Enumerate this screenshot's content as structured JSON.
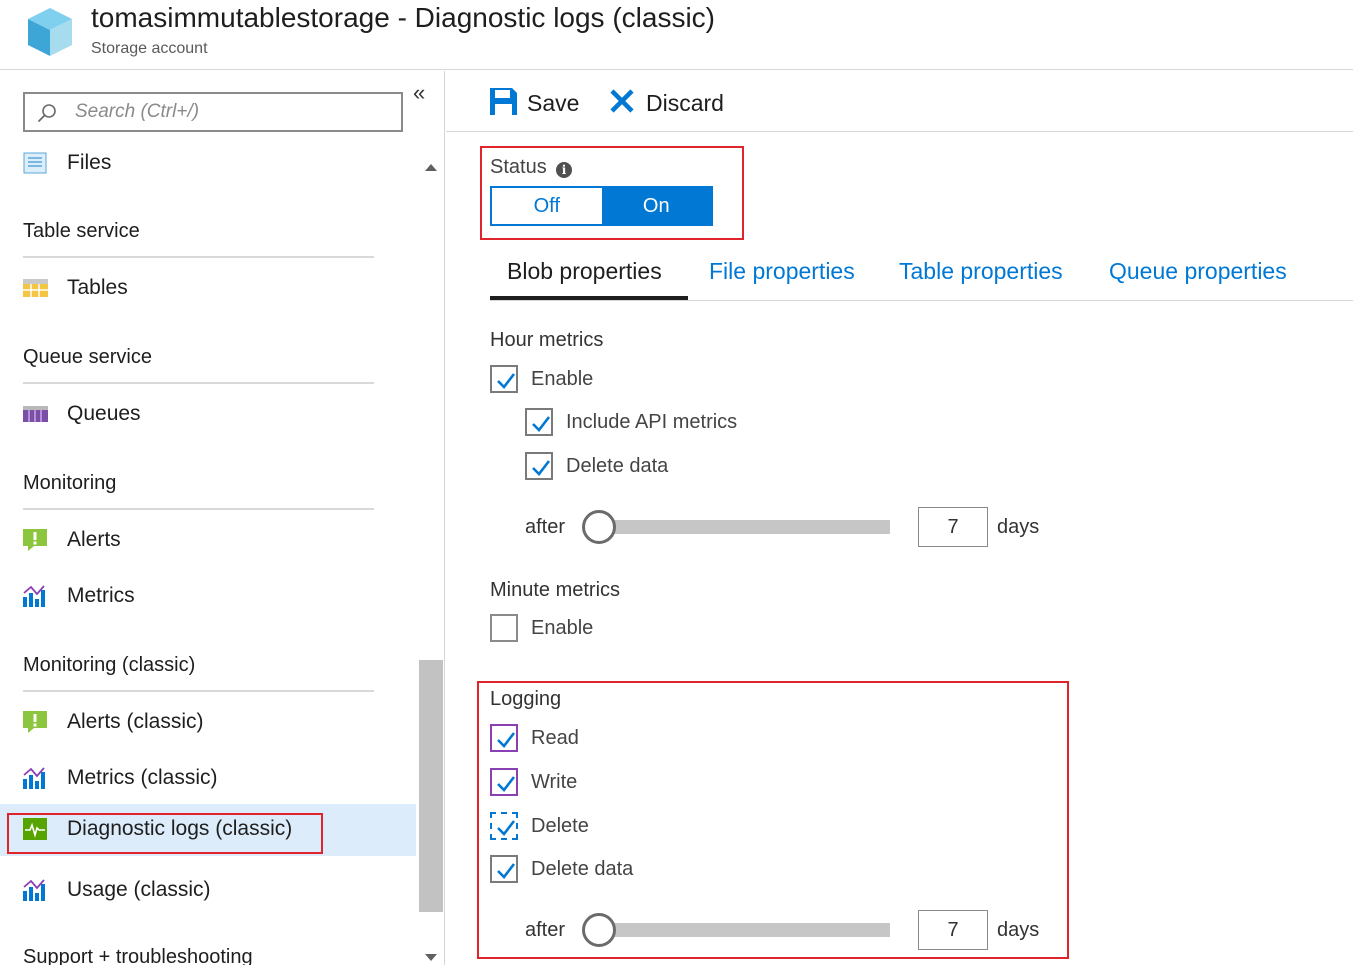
{
  "header": {
    "title": "tomasimmutablestorage - Diagnostic logs (classic)",
    "subtitle": "Storage account",
    "icon": "storage-cube-icon"
  },
  "sidebar": {
    "search_placeholder": "Search (Ctrl+/)",
    "collapse_glyph": "«",
    "items": [
      {
        "type": "item",
        "label": "Files",
        "icon": "files-icon"
      },
      {
        "type": "section",
        "label": "Table service"
      },
      {
        "type": "item",
        "label": "Tables",
        "icon": "tables-icon"
      },
      {
        "type": "section",
        "label": "Queue service"
      },
      {
        "type": "item",
        "label": "Queues",
        "icon": "queues-icon"
      },
      {
        "type": "section",
        "label": "Monitoring"
      },
      {
        "type": "item",
        "label": "Alerts",
        "icon": "alert-icon"
      },
      {
        "type": "item",
        "label": "Metrics",
        "icon": "metrics-icon"
      },
      {
        "type": "section",
        "label": "Monitoring (classic)"
      },
      {
        "type": "item",
        "label": "Alerts (classic)",
        "icon": "alert-icon"
      },
      {
        "type": "item",
        "label": "Metrics (classic)",
        "icon": "metrics-icon"
      },
      {
        "type": "item",
        "label": "Diagnostic logs (classic)",
        "icon": "diagnostic-logs-icon",
        "selected": true
      },
      {
        "type": "item",
        "label": "Usage (classic)",
        "icon": "metrics-icon"
      },
      {
        "type": "section",
        "label": "Support + troubleshooting"
      }
    ]
  },
  "toolbar": {
    "save_label": "Save",
    "discard_label": "Discard"
  },
  "status": {
    "label": "Status",
    "off_label": "Off",
    "on_label": "On",
    "value": "On"
  },
  "tabs": [
    {
      "label": "Blob properties",
      "active": true
    },
    {
      "label": "File properties",
      "active": false
    },
    {
      "label": "Table properties",
      "active": false
    },
    {
      "label": "Queue properties",
      "active": false
    }
  ],
  "hour_metrics": {
    "title": "Hour metrics",
    "enable_label": "Enable",
    "enable_checked": true,
    "include_api_label": "Include API metrics",
    "include_api_checked": true,
    "delete_data_label": "Delete data",
    "delete_data_checked": true,
    "after_label": "after",
    "days_value": "7",
    "days_unit": "days",
    "slider_fraction": 0.0
  },
  "minute_metrics": {
    "title": "Minute metrics",
    "enable_label": "Enable",
    "enable_checked": false
  },
  "logging": {
    "title": "Logging",
    "read_label": "Read",
    "read_checked": true,
    "write_label": "Write",
    "write_checked": true,
    "delete_label": "Delete",
    "delete_checked": true,
    "delete_data_label": "Delete data",
    "delete_data_checked": true,
    "after_label": "after",
    "days_value": "7",
    "days_unit": "days",
    "slider_fraction": 0.0
  },
  "colors": {
    "accent": "#0078d4",
    "highlight_box": "#e0242c",
    "selected_bg": "#ddecfb"
  }
}
